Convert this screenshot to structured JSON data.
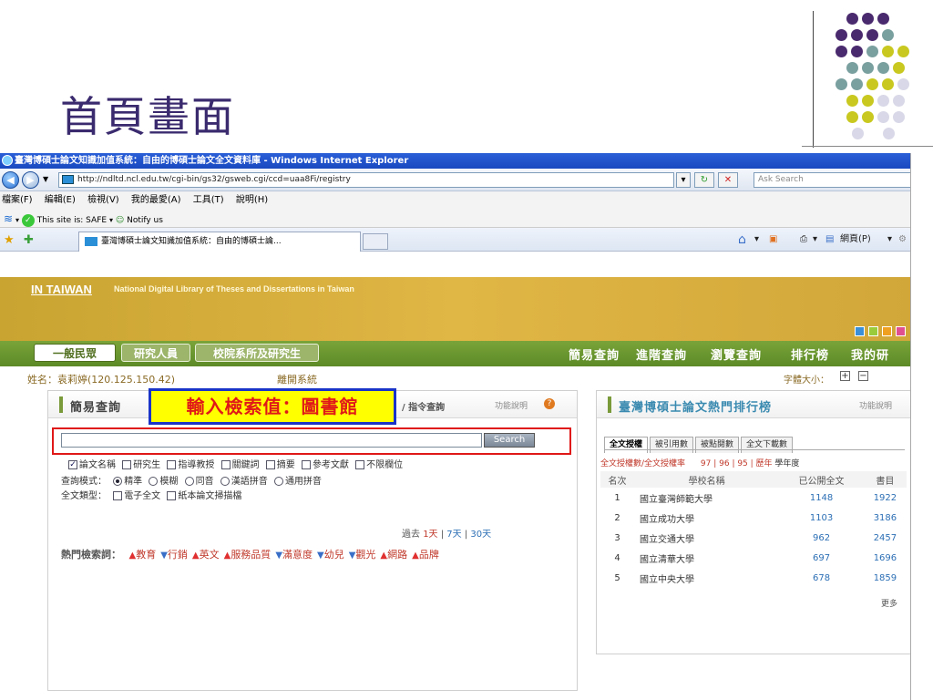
{
  "slide": {
    "title": "首頁畫面"
  },
  "decor": {
    "dot_colors": [
      "#4a2a6e",
      "#7a9f9f",
      "#c8c820",
      "#d8d8e8"
    ]
  },
  "window": {
    "title": "臺灣博碩士論文知識加值系統：自由的博碩士論文全文資料庫 - Windows Internet Explorer"
  },
  "address": {
    "url": "http://ndltd.ncl.edu.tw/cgi-bin/gs32/gsweb.cgi/ccd=uaa8Fi/registry",
    "search_placeholder": "Ask Search"
  },
  "menu": {
    "items": [
      "檔案(F)",
      "編輯(E)",
      "檢視(V)",
      "我的最愛(A)",
      "工具(T)",
      "說明(H)"
    ]
  },
  "links": {
    "safe": "This site is: SAFE",
    "notify": "Notify us"
  },
  "tab": {
    "title": "臺灣博碩士論文知識加值系統：自由的博碩士論..."
  },
  "commands": {
    "page": "網頁(P)"
  },
  "site": {
    "brand": "IN TAIWAN",
    "brand_sub": "National Digital Library of Theses and Dissertations in Taiwan",
    "swatch_colors": [
      "#3a8fd8",
      "#9acb3a",
      "#f0a020",
      "#e05090"
    ],
    "roles": [
      "一般民眾",
      "研究人員",
      "校院系所及研究生"
    ],
    "nav": [
      "簡易查詢",
      "進階查詢",
      "瀏覽查詢",
      "排行榜",
      "我的研"
    ],
    "user": "姓名：袁莉婷(120.125.150.42)",
    "logout": "離開系統",
    "fontsize": "字體大小："
  },
  "search_panel": {
    "title": "簡易查詢",
    "alt": "/ 指令查詢",
    "help": "功能說明",
    "button": "Search",
    "callout": "輸入檢索值：圖書館",
    "fields": [
      "論文名稱",
      "研究生",
      "指導教授",
      "關鍵詞",
      "摘要",
      "參考文獻",
      "不限欄位"
    ],
    "mode_label": "查詢模式：",
    "modes": [
      "精準",
      "模糊",
      "同音",
      "漢語拼音",
      "通用拼音"
    ],
    "type_label": "全文類型：",
    "types": [
      "電子全文",
      "紙本論文掃描檔"
    ],
    "period_label": "過去",
    "periods": [
      "1天",
      "7天",
      "30天"
    ],
    "hot_label": "熱門檢索詞：",
    "hot_terms": [
      {
        "t": "教育",
        "d": "up"
      },
      {
        "t": "行銷",
        "d": "down"
      },
      {
        "t": "英文",
        "d": "up"
      },
      {
        "t": "服務品質",
        "d": "up"
      },
      {
        "t": "滿意度",
        "d": "down"
      },
      {
        "t": "幼兒",
        "d": "down"
      },
      {
        "t": "觀光",
        "d": "down"
      },
      {
        "t": "網路",
        "d": "up"
      },
      {
        "t": "品牌",
        "d": "up"
      }
    ]
  },
  "rank_panel": {
    "title": "臺灣博碩士論文熱門排行榜",
    "help": "功能說明",
    "tabs": [
      "全文授權",
      "被引用數",
      "被點閱數",
      "全文下載數"
    ],
    "metric": "全文授權數/全文授權率",
    "years": "97 | 96 | 95 | 歷年",
    "year_label": "學年度",
    "columns": [
      "名次",
      "學校名稱",
      "已公開全文",
      "書目"
    ],
    "rows": [
      [
        "1",
        "國立臺灣師範大學",
        "1148",
        "1922"
      ],
      [
        "2",
        "國立成功大學",
        "1103",
        "3186"
      ],
      [
        "3",
        "國立交通大學",
        "962",
        "2457"
      ],
      [
        "4",
        "國立清華大學",
        "697",
        "1696"
      ],
      [
        "5",
        "國立中央大學",
        "678",
        "1859"
      ]
    ],
    "more": "更多"
  }
}
